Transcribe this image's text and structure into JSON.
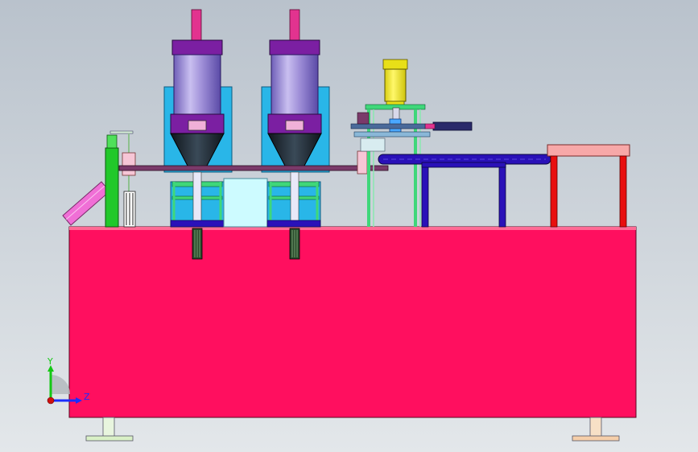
{
  "view": {
    "background_top": "#b9c2cc",
    "background_bottom": "#e3e7ea"
  },
  "axis_triad": {
    "y_label": "Y",
    "z_label": "Z",
    "y_color": "#14c814",
    "z_color": "#1a2cff",
    "origin_color": "#d01010"
  },
  "colors": {
    "base": "#ff0f5f",
    "cylinder_body": "#9f8fd8",
    "cylinder_rod": "#e2338f",
    "cylinder_cap": "#7b1fa2",
    "hopper_frame": "#29b6e8",
    "hopper_funnel": "#1c2630",
    "lift_cylinder": "#f2ea2c",
    "conveyor": "#2a11b8",
    "table_top": "#f7a8a8",
    "table_leg": "#e80f0f",
    "frame_rods": "#3fd77a",
    "green_post": "#21c82a",
    "chute": "#f06fd6",
    "feet": "#d9f0c6"
  }
}
